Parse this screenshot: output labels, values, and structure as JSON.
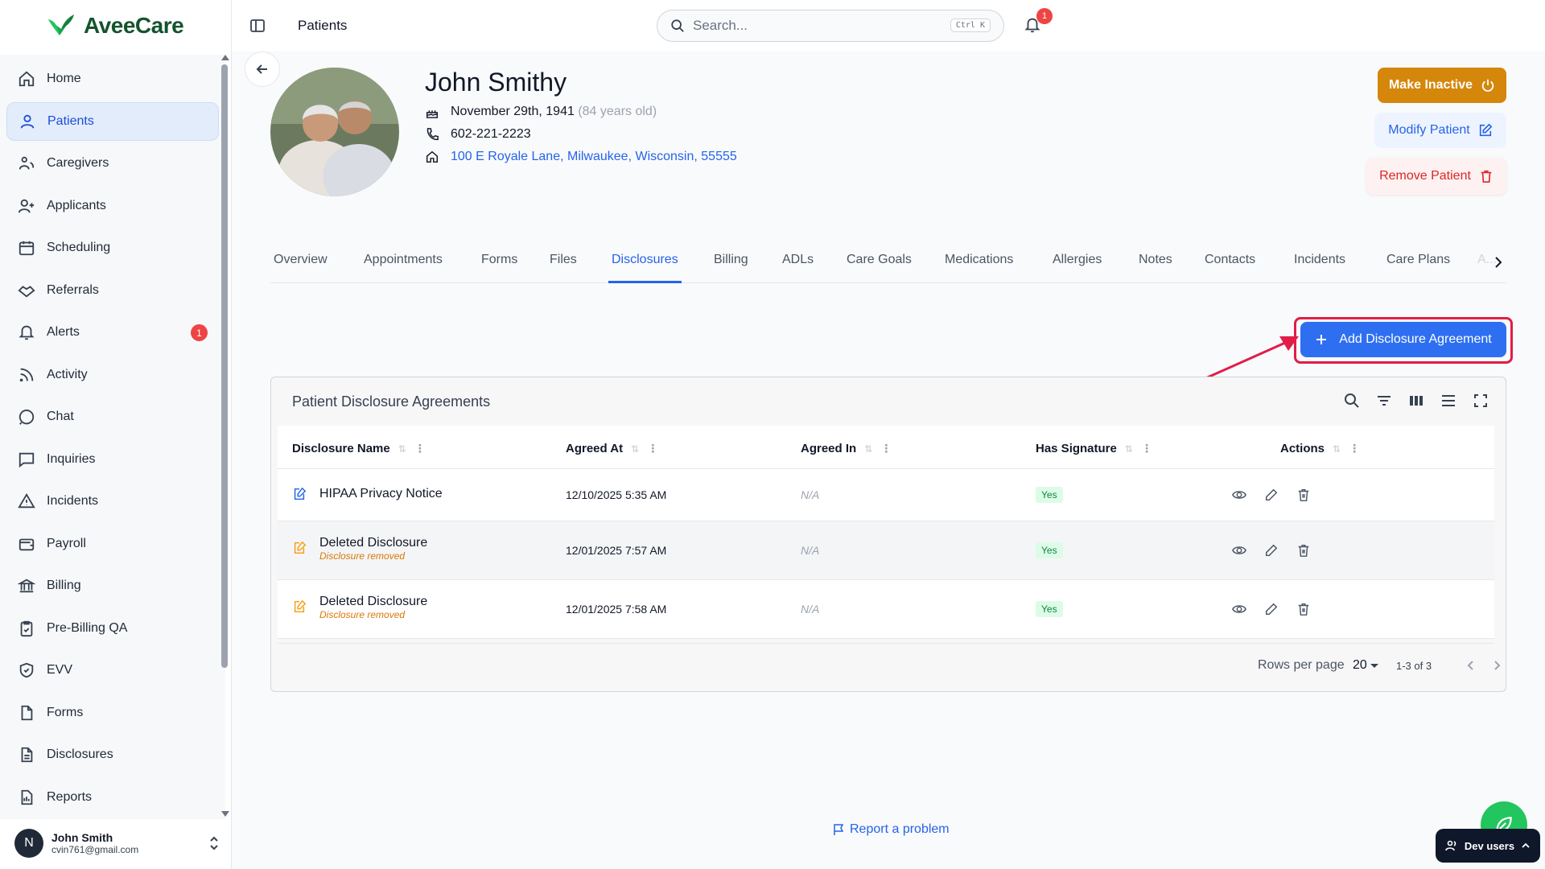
{
  "app": {
    "name": "AveeCare"
  },
  "header": {
    "title": "Patients",
    "search_placeholder": "Search...",
    "search_shortcut": "Ctrl K",
    "notification_count": "1"
  },
  "sidebar": {
    "items": [
      {
        "label": "Home",
        "icon": "home-icon"
      },
      {
        "label": "Patients",
        "icon": "user-icon",
        "active": true
      },
      {
        "label": "Caregivers",
        "icon": "caregivers-icon"
      },
      {
        "label": "Applicants",
        "icon": "user-plus-icon"
      },
      {
        "label": "Scheduling",
        "icon": "calendar-icon"
      },
      {
        "label": "Referrals",
        "icon": "handshake-icon"
      },
      {
        "label": "Alerts",
        "icon": "bell-icon",
        "badge": "1"
      },
      {
        "label": "Activity",
        "icon": "rss-icon"
      },
      {
        "label": "Chat",
        "icon": "chat-icon"
      },
      {
        "label": "Inquiries",
        "icon": "message-square-icon"
      },
      {
        "label": "Incidents",
        "icon": "warning-icon"
      },
      {
        "label": "Payroll",
        "icon": "wallet-icon"
      },
      {
        "label": "Billing",
        "icon": "bank-icon"
      },
      {
        "label": "Pre-Billing QA",
        "icon": "clipboard-check-icon"
      },
      {
        "label": "EVV",
        "icon": "shield-check-icon"
      },
      {
        "label": "Forms",
        "icon": "file-icon"
      },
      {
        "label": "Disclosures",
        "icon": "file-text-icon"
      },
      {
        "label": "Reports",
        "icon": "report-icon"
      }
    ],
    "user": {
      "initial": "N",
      "name": "John Smith",
      "email": "cvin761@gmail.com"
    }
  },
  "patient": {
    "name": "John Smithy",
    "dob": "November 29th, 1941",
    "age": "(84 years old)",
    "phone": "602-221-2223",
    "address": "100 E Royale Lane, Milwaukee, Wisconsin, 55555"
  },
  "actions": {
    "make_inactive": "Make Inactive",
    "modify": "Modify Patient",
    "remove": "Remove Patient"
  },
  "tabs": [
    "Overview",
    "Appointments",
    "Forms",
    "Files",
    "Disclosures",
    "Billing",
    "ADLs",
    "Care Goals",
    "Medications",
    "Allergies",
    "Notes",
    "Contacts",
    "Incidents",
    "Care Plans",
    "A..."
  ],
  "active_tab": "Disclosures",
  "add_button": "Add Disclosure Agreement",
  "table": {
    "title": "Patient Disclosure Agreements",
    "columns": [
      "Disclosure Name",
      "Agreed At",
      "Agreed In",
      "Has Signature",
      "Actions"
    ],
    "rows": [
      {
        "name": "HIPAA Privacy Notice",
        "sub": "",
        "agreed_at": "12/10/2025 5:35 AM",
        "agreed_in": "N/A",
        "signature": "Yes"
      },
      {
        "name": "Deleted Disclosure",
        "sub": "Disclosure removed",
        "agreed_at": "12/01/2025 7:57 AM",
        "agreed_in": "N/A",
        "signature": "Yes"
      },
      {
        "name": "Deleted Disclosure",
        "sub": "Disclosure removed",
        "agreed_at": "12/01/2025 7:58 AM",
        "agreed_in": "N/A",
        "signature": "Yes"
      }
    ],
    "footer": {
      "rows_per_page_label": "Rows per page",
      "rows_per_page": "20",
      "range": "1-3 of 3"
    }
  },
  "report_problem": "Report a problem",
  "dev_users": "Dev users",
  "colors": {
    "primary": "#2563eb",
    "warning": "#d4870b",
    "danger": "#dc2626",
    "highlight": "#e11d48"
  }
}
